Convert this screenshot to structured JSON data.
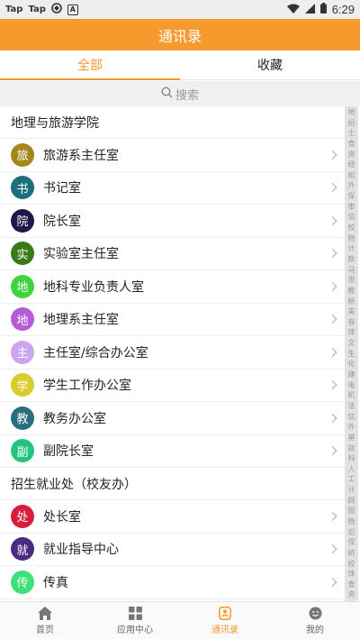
{
  "status_bar": {
    "left_icons": [
      "Tap",
      "Tap"
    ],
    "box_icon_text": "A",
    "time": "6:29"
  },
  "header": {
    "title": "通讯录"
  },
  "tabs": [
    {
      "label": "全部",
      "active": true
    },
    {
      "label": "收藏",
      "active": false
    }
  ],
  "search": {
    "placeholder": "搜索"
  },
  "sections": [
    {
      "title": "地理与旅游学院",
      "items": [
        {
          "avatar": "旅",
          "label": "旅游系主任室",
          "color": "#a6851f"
        },
        {
          "avatar": "书",
          "label": "书记室",
          "color": "#1c6f7d"
        },
        {
          "avatar": "院",
          "label": "院长室",
          "color": "#21174a"
        },
        {
          "avatar": "实",
          "label": "实验室主任室",
          "color": "#3b7a18"
        },
        {
          "avatar": "地",
          "label": "地科专业负责人室",
          "color": "#3fd43f"
        },
        {
          "avatar": "地",
          "label": "地理系主任室",
          "color": "#b35ed6"
        },
        {
          "avatar": "主",
          "label": "主任室/综合办公室",
          "color": "#caa6ee"
        },
        {
          "avatar": "学",
          "label": "学生工作办公室",
          "color": "#d8cc2a"
        },
        {
          "avatar": "教",
          "label": "教务办公室",
          "color": "#2a6f7f"
        },
        {
          "avatar": "副",
          "label": "副院长室",
          "color": "#23c47e"
        }
      ]
    },
    {
      "title": "招生就业处（校友办）",
      "items": [
        {
          "avatar": "处",
          "label": "处长室",
          "color": "#d81e3c"
        },
        {
          "avatar": "就",
          "label": "就业指导中心",
          "color": "#4b2a82"
        },
        {
          "avatar": "传",
          "label": "传真",
          "color": "#3ee07a"
        }
      ]
    }
  ],
  "index_bar": [
    "地",
    "招",
    "士",
    "食",
    "资",
    "经",
    "组",
    "外",
    "保",
    "审",
    "信",
    "校",
    "物",
    "计",
    "数",
    "马",
    "思",
    "教",
    "新",
    "美",
    "音",
    "体",
    "文",
    "生",
    "化",
    "建",
    "电",
    "机",
    "法",
    "信",
    "外",
    "基",
    "就",
    "科",
    "人",
    "工",
    "计",
    "网",
    "图",
    "档",
    "后",
    "保",
    "统",
    "校",
    "体",
    "食",
    "资"
  ],
  "bottom_nav": [
    {
      "label": "首页",
      "icon": "home-icon",
      "active": false
    },
    {
      "label": "应用中心",
      "icon": "apps-icon",
      "active": false
    },
    {
      "label": "通讯录",
      "icon": "contacts-icon",
      "active": true
    },
    {
      "label": "我的",
      "icon": "profile-icon",
      "active": false
    }
  ],
  "colors": {
    "accent": "#f7962a",
    "header": "#f79a2d"
  }
}
